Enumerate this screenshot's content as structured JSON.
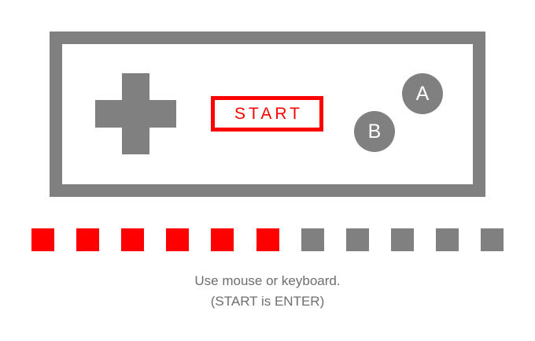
{
  "controller": {
    "start_label": "START",
    "button_a_label": "A",
    "button_b_label": "B"
  },
  "progress": {
    "total": 11,
    "filled": 6,
    "filled_color": "#ff0000",
    "empty_color": "#808080"
  },
  "instructions": {
    "line1": "Use mouse or keyboard.",
    "line2": "(START is ENTER)"
  },
  "colors": {
    "frame": "#808080",
    "accent": "#ff0000",
    "text": "#6e6e6e",
    "background": "#ffffff"
  }
}
